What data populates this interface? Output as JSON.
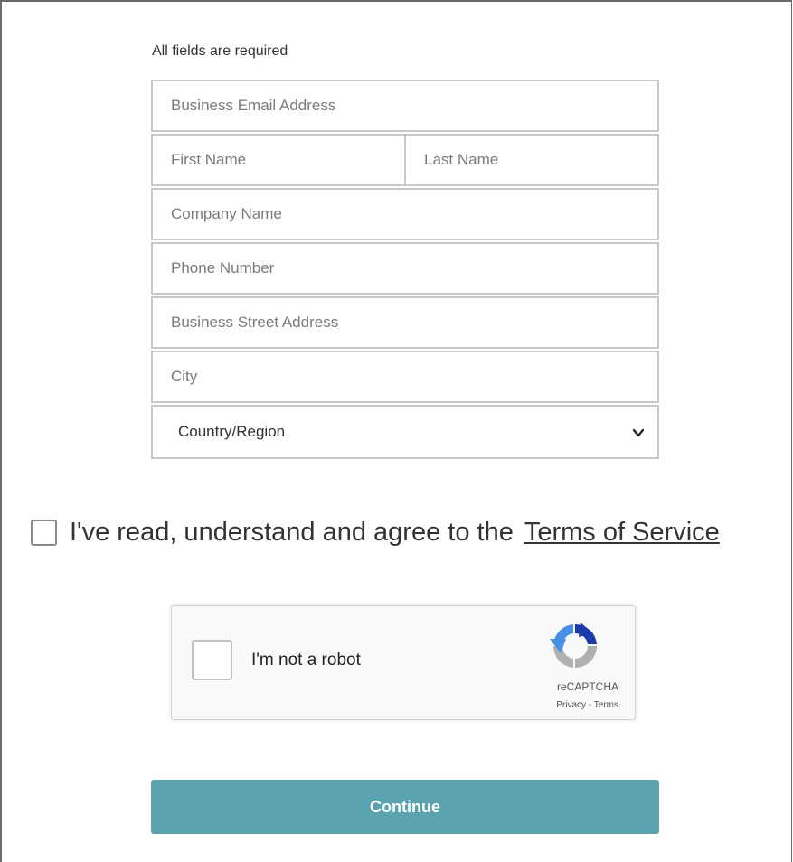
{
  "form": {
    "required_note": "All fields are required",
    "fields": {
      "email_placeholder": "Business Email Address",
      "first_name_placeholder": "First Name",
      "last_name_placeholder": "Last Name",
      "company_placeholder": "Company Name",
      "phone_placeholder": "Phone Number",
      "street_placeholder": "Business Street Address",
      "city_placeholder": "City",
      "country_selected": "Country/Region"
    }
  },
  "terms": {
    "text": "I've read, understand and agree to the",
    "link_label": "Terms of Service",
    "checked": false
  },
  "recaptcha": {
    "label": "I'm not a robot",
    "brand": "reCAPTCHA",
    "privacy_label": "Privacy",
    "separator": " - ",
    "terms_label": "Terms",
    "checked": false,
    "colors": {
      "blue": "#4a90e2",
      "dark_blue": "#1c3aa9",
      "gray": "#b0b0b0"
    }
  },
  "continue_button": {
    "label": "Continue",
    "color": "#5ba3ae"
  }
}
